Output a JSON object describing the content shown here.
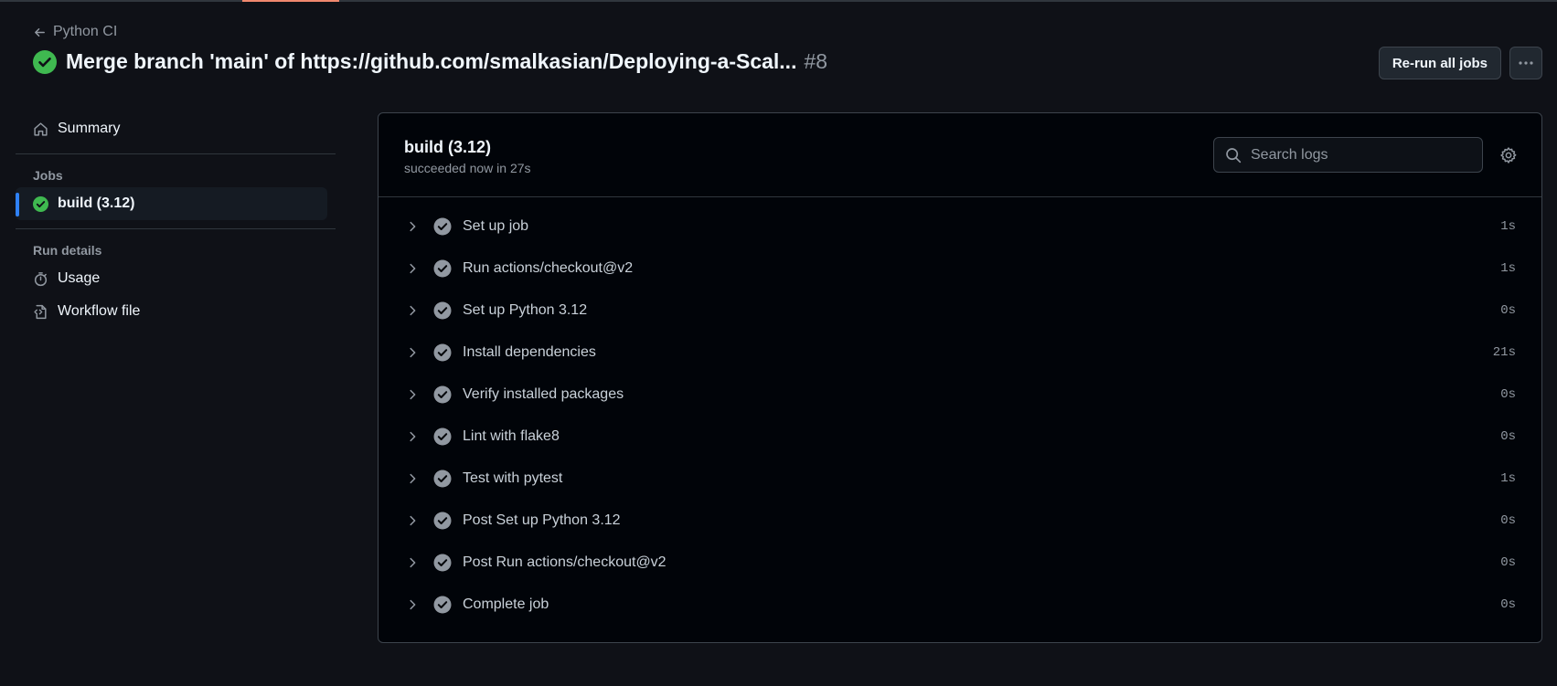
{
  "header": {
    "back_label": "Python CI",
    "title": "Merge branch 'main' of https://github.com/smalkasian/Deploying-a-Scal...",
    "run_number": "#8",
    "rerun_label": "Re-run all jobs"
  },
  "sidebar": {
    "summary_label": "Summary",
    "jobs_heading": "Jobs",
    "job_label": "build (3.12)",
    "run_details_heading": "Run details",
    "usage_label": "Usage",
    "workflow_label": "Workflow file"
  },
  "job": {
    "title": "build (3.12)",
    "subtitle": "succeeded now in 27s",
    "search_placeholder": "Search logs"
  },
  "steps": [
    {
      "name": "Set up job",
      "time": "1s"
    },
    {
      "name": "Run actions/checkout@v2",
      "time": "1s"
    },
    {
      "name": "Set up Python 3.12",
      "time": "0s"
    },
    {
      "name": "Install dependencies",
      "time": "21s"
    },
    {
      "name": "Verify installed packages",
      "time": "0s"
    },
    {
      "name": "Lint with flake8",
      "time": "0s"
    },
    {
      "name": "Test with pytest",
      "time": "1s"
    },
    {
      "name": "Post Set up Python 3.12",
      "time": "0s"
    },
    {
      "name": "Post Run actions/checkout@v2",
      "time": "0s"
    },
    {
      "name": "Complete job",
      "time": "0s"
    }
  ],
  "colors": {
    "success": "#3fb950",
    "step_check": "#9198a1",
    "active_bar": "#2f81f7",
    "background": "#0f1117"
  }
}
